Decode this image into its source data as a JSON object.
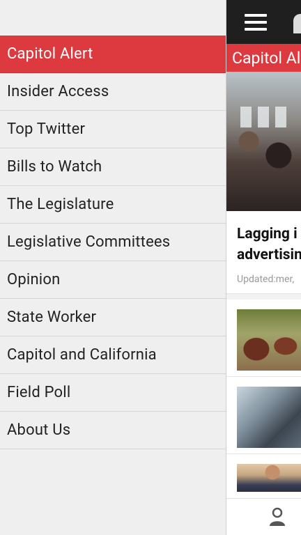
{
  "drawer": {
    "items": [
      {
        "label": "Capitol Alert",
        "active": true
      },
      {
        "label": "Insider Access"
      },
      {
        "label": "Top Twitter"
      },
      {
        "label": "Bills to Watch"
      },
      {
        "label": "The Legislature"
      },
      {
        "label": "Legislative Committees"
      },
      {
        "label": "Opinion"
      },
      {
        "label": "State Worker"
      },
      {
        "label": "Capitol and California"
      },
      {
        "label": "Field Poll"
      },
      {
        "label": "About Us"
      }
    ]
  },
  "main": {
    "section_title": "Capitol Alert",
    "headline": "Lagging in advertising",
    "headline_line1": "Lagging i",
    "headline_line2": "advertisin",
    "updated": "Updated:mer,"
  },
  "colors": {
    "accent": "#dd3a3f",
    "appbar": "#1f1f1f"
  },
  "icons": [
    "menu-icon",
    "logo-icon",
    "user-profile-icon"
  ]
}
